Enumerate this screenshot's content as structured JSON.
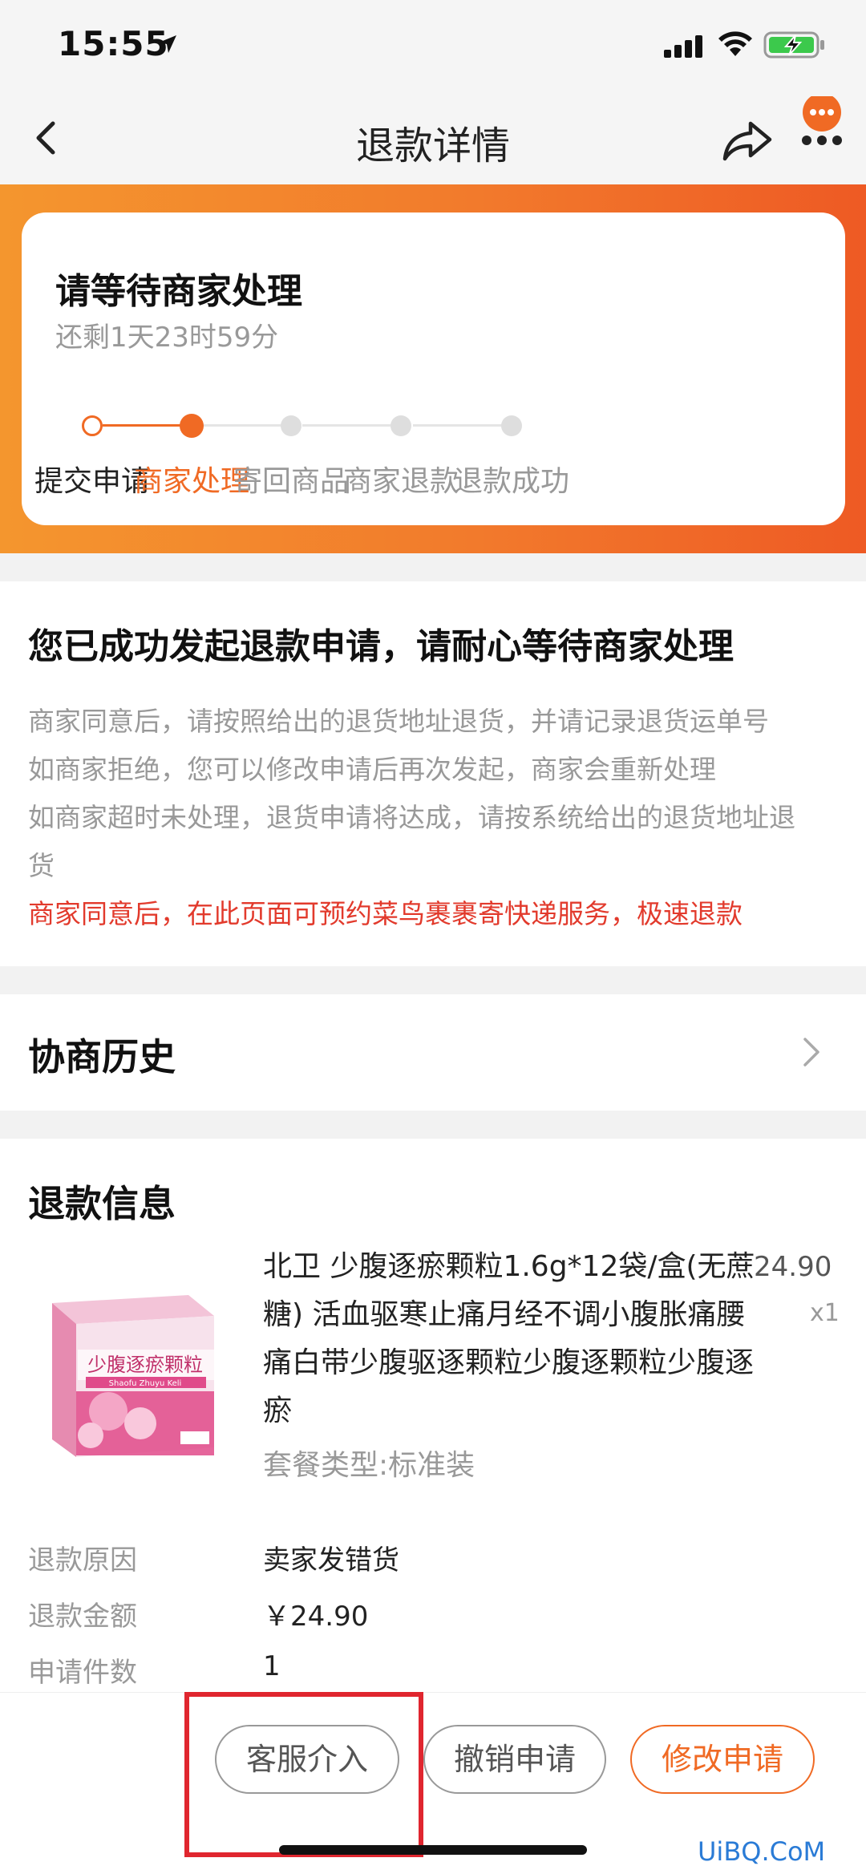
{
  "status_bar": {
    "time": "15:55"
  },
  "nav": {
    "title": "退款详情"
  },
  "status_card": {
    "title": "请等待商家处理",
    "subtitle": "还剩1天23时59分",
    "steps": [
      "提交申请",
      "商家处理",
      "寄回商品",
      "商家退款",
      "退款成功"
    ],
    "current_step_index": 1
  },
  "notice": {
    "title": "您已成功发起退款申请，请耐心等待商家处理",
    "lines": [
      "商家同意后，请按照给出的退货地址退货，并请记录退货运单号",
      "如商家拒绝，您可以修改申请后再次发起，商家会重新处理",
      "如商家超时未处理，退货申请将达成，请按系统给出的退货地址退",
      "货"
    ],
    "highlight": "商家同意后，在此页面可预约菜鸟裹裹寄快递服务，极速退款"
  },
  "history": {
    "title": "协商历史"
  },
  "refund": {
    "title": "退款信息",
    "product": {
      "name": "北卫 少腹逐瘀颗粒1.6g*12袋/盒(无蔗糖) 活血驱寒止痛月经不调小腹胀痛腰痛白带少腹驱逐颗粒少腹逐颗粒少腹逐瘀",
      "price": "24.90",
      "quantity": "x1",
      "package": "套餐类型:标准装",
      "box_text_cn": "少腹逐瘀颗粒",
      "box_text_en": "Shaofu Zhuyu Keli"
    },
    "rows": [
      {
        "label": "退款原因",
        "value": "卖家发错货"
      },
      {
        "label": "退款金额",
        "value": "￥24.90"
      },
      {
        "label": "申请件数",
        "value": "1"
      }
    ]
  },
  "actions": {
    "service": "客服介入",
    "cancel": "撤销申请",
    "modify": "修改申请"
  },
  "watermark": "UiBQ.CoM",
  "colors": {
    "accent": "#f06a24",
    "highlight_red": "#e23a2c",
    "annotation_red": "#e0262f"
  }
}
